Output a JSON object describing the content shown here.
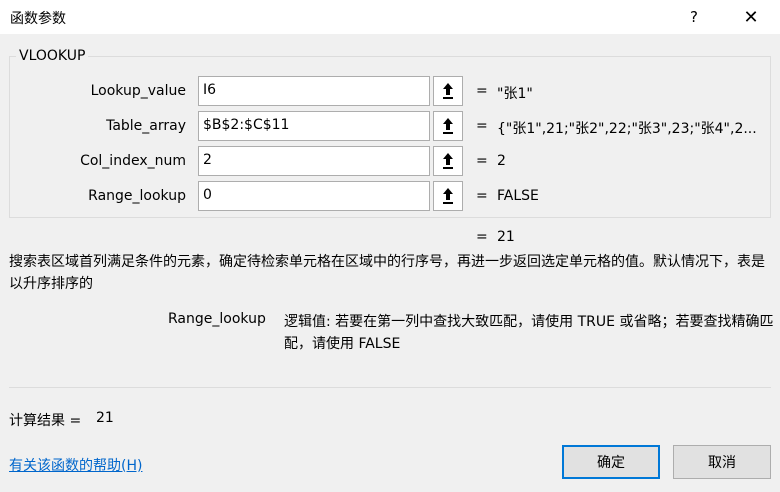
{
  "window": {
    "title": "函数参数",
    "help_glyph": "?",
    "close_glyph": "✕"
  },
  "function_group": {
    "name": "VLOOKUP",
    "args": [
      {
        "label": "Lookup_value",
        "input": "I6",
        "value": "\"张1\""
      },
      {
        "label": "Table_array",
        "input": "$B$2:$C$11",
        "value": "{\"张1\",21;\"张2\",22;\"张3\",23;\"张4\",2..."
      },
      {
        "label": "Col_index_num",
        "input": "2",
        "value": "2"
      },
      {
        "label": "Range_lookup",
        "input": "0",
        "value": "FALSE"
      }
    ],
    "equals": "="
  },
  "result": {
    "equals": "=",
    "value": "21"
  },
  "description": "搜索表区域首列满足条件的元素，确定待检索单元格在区域中的行序号，再进一步返回选定单元格的值。默认情况下，表是以升序排序的",
  "param_help": {
    "name": "Range_lookup",
    "text": "逻辑值: 若要在第一列中查找大致匹配，请使用 TRUE 或省略；若要查找精确匹配，请使用 FALSE"
  },
  "calc": {
    "label": "计算结果 =",
    "value": "21"
  },
  "help_link": "有关该函数的帮助(H)",
  "buttons": {
    "ok": "确定",
    "cancel": "取消"
  }
}
